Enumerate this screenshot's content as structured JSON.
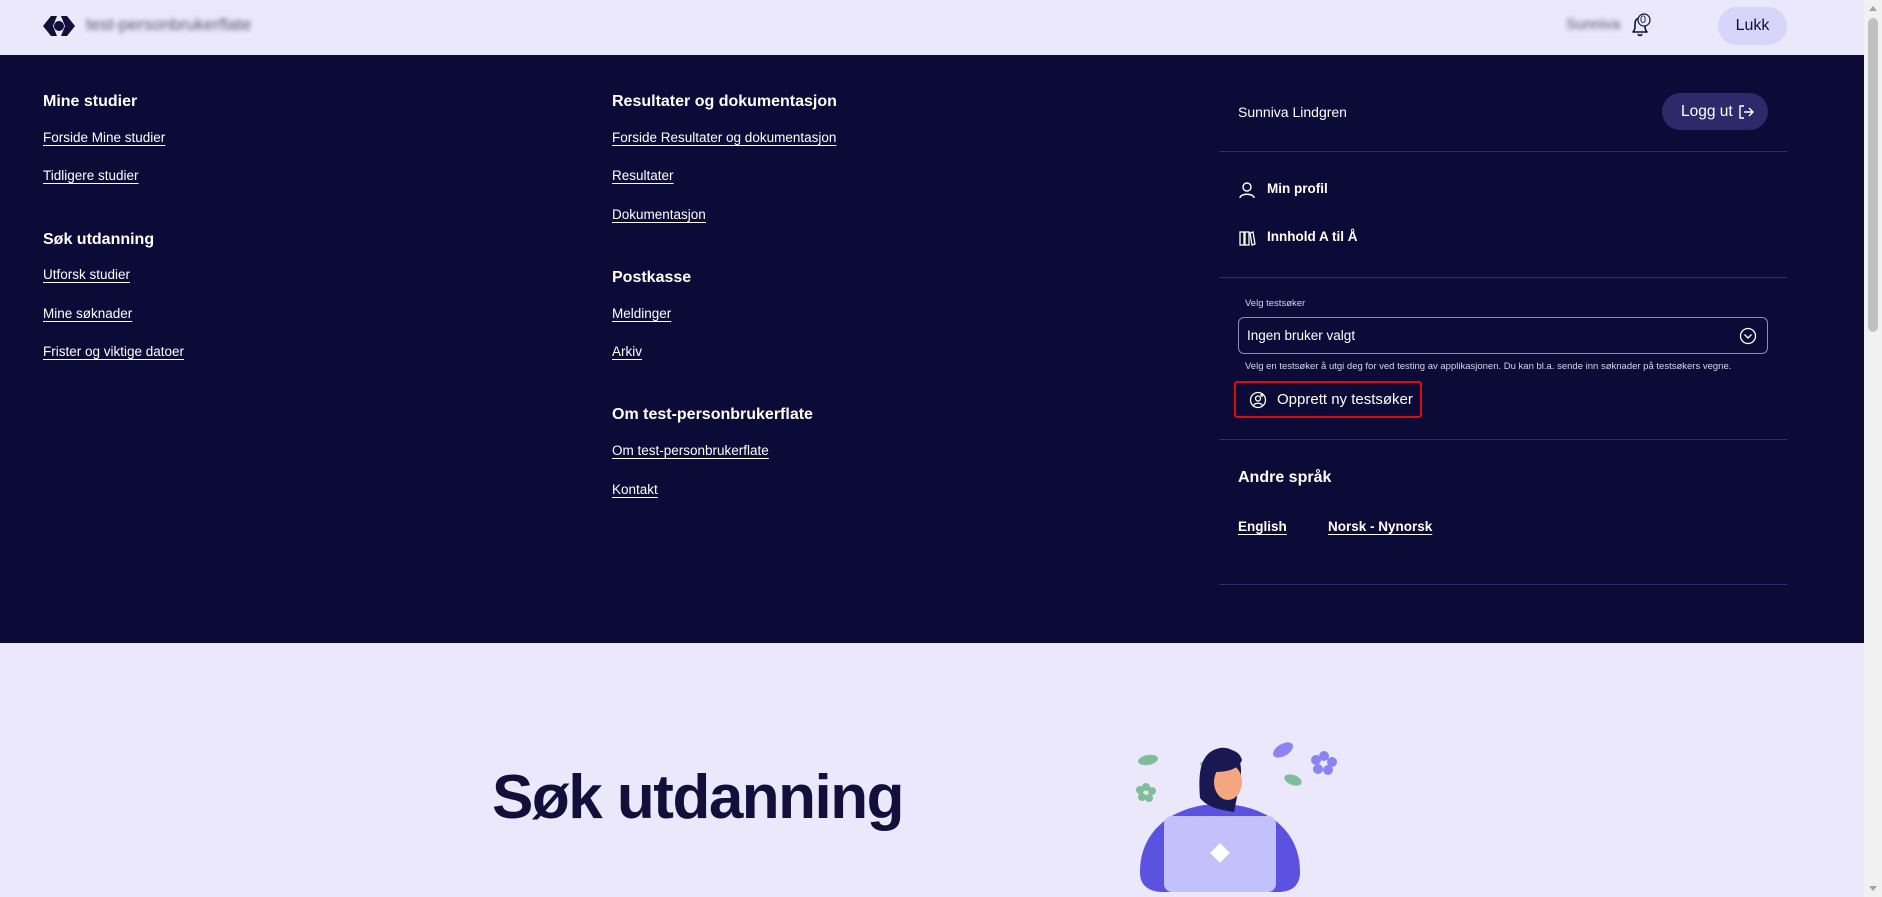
{
  "topbar": {
    "site_name": "test-personbrukerflate",
    "user_short": "Sunniva",
    "notification_count": "0",
    "close_label": "Lukk"
  },
  "menu": {
    "col1": {
      "section1_title": "Mine studier",
      "section1_links": [
        "Forside Mine studier",
        "Tidligere studier"
      ],
      "section2_title": "Søk utdanning",
      "section2_links": [
        "Utforsk studier",
        "Mine søknader",
        "Frister og viktige datoer"
      ]
    },
    "col2": {
      "section1_title": "Resultater og dokumentasjon",
      "section1_links": [
        "Forside Resultater og dokumentasjon",
        "Resultater",
        "Dokumentasjon"
      ],
      "section2_title": "Postkasse",
      "section2_links": [
        "Meldinger",
        "Arkiv"
      ],
      "section3_title": "Om test-personbrukerflate",
      "section3_links": [
        "Om test-personbrukerflate",
        "Kontakt"
      ]
    },
    "user_panel": {
      "user_name": "Sunniva Lindgren",
      "logout_label": "Logg ut",
      "profile_label": "Min profil",
      "content_az_label": "Innhold A til Å",
      "test_user_label": "Velg testsøker",
      "test_user_value": "Ingen bruker valgt",
      "test_user_help": "Velg en testsøker å utgi deg for ved testing av applikasjonen. Du kan bl.a. sende inn søknader på testsøkers vegne.",
      "create_test_user_label": "Opprett ny testsøker",
      "other_languages_title": "Andre språk",
      "languages": [
        "English",
        "Norsk - Nynorsk"
      ]
    }
  },
  "hero": {
    "title": "Søk utdanning"
  },
  "colors": {
    "menu_bg": "#0c0a36",
    "page_bg": "#ebe8fb",
    "accent": "#2c2a6b",
    "highlight_border": "#e10b0b"
  }
}
